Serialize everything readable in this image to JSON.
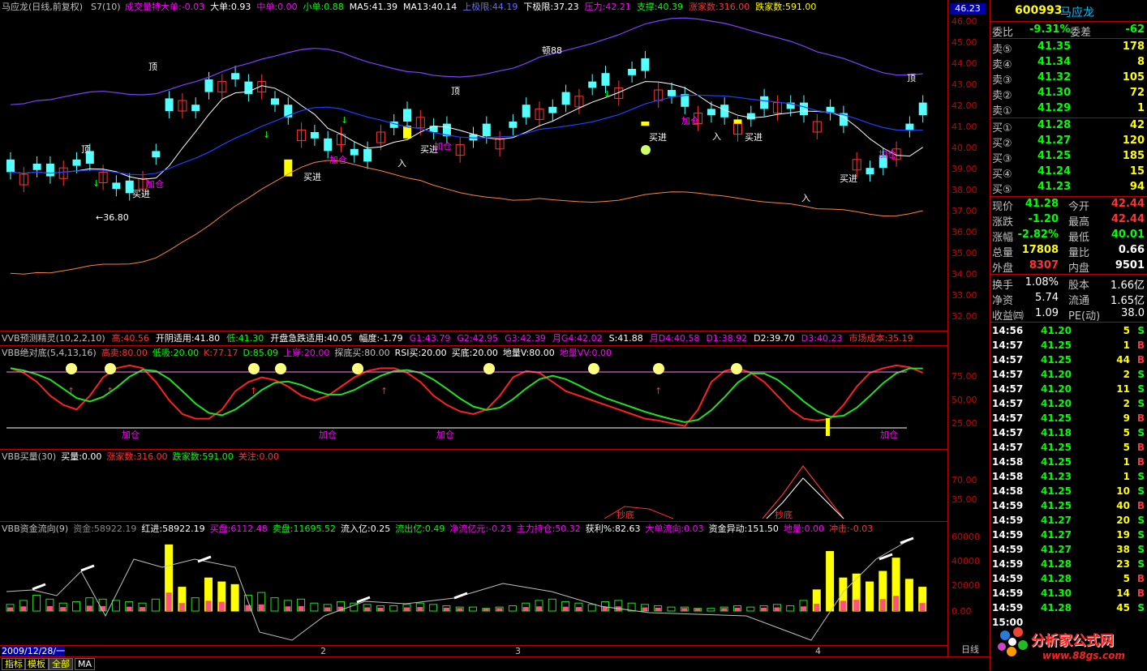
{
  "stock": {
    "code": "600993",
    "name": "马应龙"
  },
  "main_header": {
    "name": "马应龙(日线,前复权)",
    "s7": "S7(10)",
    "items": [
      {
        "text": "成交量特大单:-0.03",
        "color": "#ff00ff"
      },
      {
        "text": "大单:0.93",
        "color": "#ffffff"
      },
      {
        "text": "中单:0.00",
        "color": "#ff00ff"
      },
      {
        "text": "小单:0.88",
        "color": "#00ff00"
      },
      {
        "text": "MA5:41.39",
        "color": "#ffffff"
      },
      {
        "text": "MA13:40.14",
        "color": "#ffffff"
      },
      {
        "text": "上极限:44.19",
        "color": "#6a6aff"
      },
      {
        "text": "下极限:37.23",
        "color": "#ffffff"
      },
      {
        "text": "压力:42.21",
        "color": "#ff00ff"
      },
      {
        "text": "支撑:40.39",
        "color": "#00ff00"
      },
      {
        "text": "涨家数:316.00",
        "color": "#ff3333"
      },
      {
        "text": "跌家数:591.00",
        "color": "#ffff00"
      }
    ]
  },
  "price_axis": {
    "ticks": [
      "46.00",
      "45.00",
      "44.00",
      "43.00",
      "42.00",
      "41.00",
      "40.00",
      "39.00",
      "38.00",
      "37.00",
      "36.00",
      "35.00",
      "34.00",
      "33.00",
      "32.00"
    ],
    "current": "46.23"
  },
  "chart_annotations": {
    "peak": "顿88",
    "low": "←36.80",
    "top": "顶",
    "buy": "买进",
    "add": "加仓",
    "in": "入"
  },
  "vvb1_header": {
    "items": [
      {
        "text": "VVB预测精灵(10,2,2,10)",
        "color": "#c0c0c0"
      },
      {
        "text": "高:40.56",
        "color": "#ff3333"
      },
      {
        "text": "开阴适用:41.80",
        "color": "#ffffff"
      },
      {
        "text": "低:41.30",
        "color": "#00ff00"
      },
      {
        "text": "开盘急跌适用:40.05",
        "color": "#ffffff"
      },
      {
        "text": "幅度:-1.79",
        "color": "#ffffff"
      },
      {
        "text": "G1:43.79",
        "color": "#ff00ff"
      },
      {
        "text": "G2:42.95",
        "color": "#ff00ff"
      },
      {
        "text": "G3:42.39",
        "color": "#ff00ff"
      },
      {
        "text": "月G4:42.02",
        "color": "#ff00ff"
      },
      {
        "text": "S:41.88",
        "color": "#ffffff"
      },
      {
        "text": "月D4:40.58",
        "color": "#ff00ff"
      },
      {
        "text": "D1:38.92",
        "color": "#ff00ff"
      },
      {
        "text": "D2:39.70",
        "color": "#ffffff"
      },
      {
        "text": "D3:40.23",
        "color": "#ff00ff"
      },
      {
        "text": "市场成本:35.19",
        "color": "#ff3333"
      }
    ]
  },
  "vvb2_header": {
    "items": [
      {
        "text": "VBB绝对底(5,4,13,16)",
        "color": "#c0c0c0"
      },
      {
        "text": "高卖:80.00",
        "color": "#ff3333"
      },
      {
        "text": "低吸:20.00",
        "color": "#00ff00"
      },
      {
        "text": "K:77.17",
        "color": "#ff3333"
      },
      {
        "text": "D:85.09",
        "color": "#00ff00"
      },
      {
        "text": "上穿:20.00",
        "color": "#ff00ff"
      },
      {
        "text": "探底买:80.00",
        "color": "#c0c0c0"
      },
      {
        "text": "RSI买:20.00",
        "color": "#ffffff"
      },
      {
        "text": "买底:20.00",
        "color": "#ffffff"
      },
      {
        "text": "地量V:80.00",
        "color": "#ffffff"
      },
      {
        "text": "地量VV:0.00",
        "color": "#ff00ff"
      }
    ],
    "ticks": [
      "75.00",
      "50.00",
      "25.00"
    ],
    "label": "加仓"
  },
  "vvb3_header": {
    "items": [
      {
        "text": "VBB买量(30)",
        "color": "#c0c0c0"
      },
      {
        "text": "买量:0.00",
        "color": "#ffffff"
      },
      {
        "text": "涨家数:316.00",
        "color": "#ff3333"
      },
      {
        "text": "跌家数:591.00",
        "color": "#00ff00"
      },
      {
        "text": "关注:0.00",
        "color": "#ff3333"
      }
    ],
    "ticks": [
      "70.00",
      "35.00"
    ],
    "label": "抄底"
  },
  "vvb4_header": {
    "items": [
      {
        "text": "VBB资金流向(9)",
        "color": "#c0c0c0"
      },
      {
        "text": "资金:58922.19",
        "color": "#888888"
      },
      {
        "text": "红进:58922.19",
        "color": "#ffffff"
      },
      {
        "text": "买盘:6112.48",
        "color": "#ff00ff"
      },
      {
        "text": "卖盘:11695.52",
        "color": "#00ff00"
      },
      {
        "text": "流入亿:0.25",
        "color": "#ffffff"
      },
      {
        "text": "流出亿:0.49",
        "color": "#00ff00"
      },
      {
        "text": "净流亿元:-0.23",
        "color": "#ff00ff"
      },
      {
        "text": "主力持仓:50.32",
        "color": "#ff00ff"
      },
      {
        "text": "获利%:82.63",
        "color": "#ffffff"
      },
      {
        "text": "大单流向:0.03",
        "color": "#ff00ff"
      },
      {
        "text": "资金异动:151.50",
        "color": "#ffffff"
      },
      {
        "text": "地量:0.00",
        "color": "#ff00ff"
      },
      {
        "text": "冲击:-0.03",
        "color": "#ff3333"
      }
    ],
    "ticks": [
      "60000",
      "40000",
      "20000",
      "0.00"
    ]
  },
  "date_axis": {
    "start": "2009/12/28/一",
    "marks": [
      "2",
      "3",
      "4"
    ],
    "period": "日线"
  },
  "bottom_tabs": [
    "指标",
    "模板",
    "全部",
    "MA"
  ],
  "quote": {
    "weibi_label": "委比",
    "weibi": "-9.31%",
    "weicha_label": "委差",
    "weicha": "-62",
    "asks": [
      {
        "label": "卖⑤",
        "price": "41.35",
        "vol": "178"
      },
      {
        "label": "卖④",
        "price": "41.34",
        "vol": "8"
      },
      {
        "label": "卖③",
        "price": "41.32",
        "vol": "105"
      },
      {
        "label": "卖②",
        "price": "41.30",
        "vol": "72"
      },
      {
        "label": "卖①",
        "price": "41.29",
        "vol": "1"
      }
    ],
    "bids": [
      {
        "label": "买①",
        "price": "41.28",
        "vol": "42"
      },
      {
        "label": "买②",
        "price": "41.27",
        "vol": "120"
      },
      {
        "label": "买③",
        "price": "41.25",
        "vol": "185"
      },
      {
        "label": "买④",
        "price": "41.24",
        "vol": "15"
      },
      {
        "label": "买⑤",
        "price": "41.23",
        "vol": "94"
      }
    ],
    "stats": [
      {
        "l1": "现价",
        "v1": "41.28",
        "c1": "#00ff00",
        "l2": "今开",
        "v2": "42.44",
        "c2": "#ff3333"
      },
      {
        "l1": "涨跌",
        "v1": "-1.20",
        "c1": "#00ff00",
        "l2": "最高",
        "v2": "42.44",
        "c2": "#ff3333"
      },
      {
        "l1": "涨幅",
        "v1": "-2.82%",
        "c1": "#00ff00",
        "l2": "最低",
        "v2": "40.01",
        "c2": "#00ff00"
      },
      {
        "l1": "总量",
        "v1": "17808",
        "c1": "#ffff00",
        "l2": "量比",
        "v2": "0.66",
        "c2": "#ffffff"
      },
      {
        "l1": "外盘",
        "v1": "8307",
        "c1": "#ff3333",
        "l2": "内盘",
        "v2": "9501",
        "c2": "#ffffff"
      }
    ],
    "stats2": [
      {
        "l1": "换手",
        "v1": "1.08%",
        "l2": "股本",
        "v2": "1.66亿"
      },
      {
        "l1": "净资",
        "v1": "5.74",
        "l2": "流通",
        "v2": "1.65亿"
      },
      {
        "l1": "收益㈣",
        "v1": "1.09",
        "l2": "PE(动)",
        "v2": "38.0"
      }
    ],
    "ticks": [
      {
        "time": "14:56",
        "price": "41.20",
        "vol": "5",
        "side": "S"
      },
      {
        "time": "14:57",
        "price": "41.25",
        "vol": "1",
        "side": "B"
      },
      {
        "time": "14:57",
        "price": "41.25",
        "vol": "44",
        "side": "B"
      },
      {
        "time": "14:57",
        "price": "41.20",
        "vol": "2",
        "side": "S"
      },
      {
        "time": "14:57",
        "price": "41.20",
        "vol": "11",
        "side": "S"
      },
      {
        "time": "14:57",
        "price": "41.20",
        "vol": "2",
        "side": "S"
      },
      {
        "time": "14:57",
        "price": "41.25",
        "vol": "9",
        "side": "B"
      },
      {
        "time": "14:57",
        "price": "41.18",
        "vol": "5",
        "side": "S"
      },
      {
        "time": "14:57",
        "price": "41.25",
        "vol": "5",
        "side": "B"
      },
      {
        "time": "14:58",
        "price": "41.25",
        "vol": "1",
        "side": "B"
      },
      {
        "time": "14:58",
        "price": "41.23",
        "vol": "1",
        "side": "S"
      },
      {
        "time": "14:58",
        "price": "41.25",
        "vol": "10",
        "side": "S"
      },
      {
        "time": "14:59",
        "price": "41.25",
        "vol": "40",
        "side": "B"
      },
      {
        "time": "14:59",
        "price": "41.27",
        "vol": "20",
        "side": "S"
      },
      {
        "time": "14:59",
        "price": "41.27",
        "vol": "19",
        "side": "S"
      },
      {
        "time": "14:59",
        "price": "41.27",
        "vol": "38",
        "side": "S"
      },
      {
        "time": "14:59",
        "price": "41.28",
        "vol": "23",
        "side": "S"
      },
      {
        "time": "14:59",
        "price": "41.28",
        "vol": "5",
        "side": "B"
      },
      {
        "time": "14:59",
        "price": "41.30",
        "vol": "14",
        "side": "B"
      },
      {
        "time": "14:59",
        "price": "41.28",
        "vol": "45",
        "side": "S"
      },
      {
        "time": "15:00",
        "price": "",
        "vol": "",
        "side": ""
      }
    ],
    "watermark": "分析家公式网",
    "watermark_url": "www.88gs.com"
  }
}
